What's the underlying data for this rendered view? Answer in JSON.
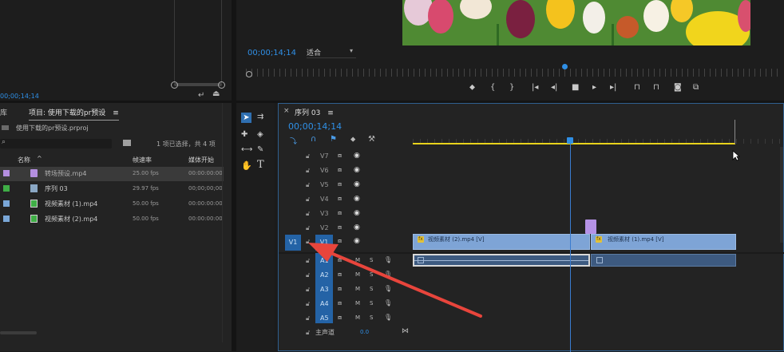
{
  "source_monitor": {
    "timecode": "00;00;14;14"
  },
  "program_monitor": {
    "timecode": "00;00;14;14",
    "fit_select": "适合",
    "transport_icons": [
      "marker-icon",
      "mark-in-icon",
      "mark-out-icon",
      "go-to-in-icon",
      "step-back-icon",
      "stop-icon",
      "play-icon",
      "step-forward-icon",
      "lift-icon",
      "extract-icon",
      "export-frame-icon",
      "compare-icon"
    ]
  },
  "project": {
    "cut_tab": "库",
    "tab_title": "项目: 使用下载的pr预设",
    "tab_menu": "≡",
    "file_name": "使用下载的pr预设.prproj",
    "selection_info": "1 项已选择，共 4 项",
    "columns": [
      "名称",
      "帧速率",
      "媒体开始"
    ],
    "rows": [
      {
        "color": "#b48fe0",
        "icon": "preset-icon",
        "name": "转场预设.mp4",
        "fps": "25.00 fps",
        "start": "00:00:00:00",
        "selected": true
      },
      {
        "color": "#3fae46",
        "icon": "sequence-icon",
        "name": "序列 03",
        "fps": "29.97 fps",
        "start": "00;00;00;00",
        "selected": false
      },
      {
        "color": "#7aa7d8",
        "icon": "video-clip-icon",
        "name": "视频素材 (1).mp4",
        "fps": "50.00 fps",
        "start": "00:00:00:00",
        "selected": false
      },
      {
        "color": "#7aa7d8",
        "icon": "video-clip-icon",
        "name": "视频素材 (2).mp4",
        "fps": "50.00 fps",
        "start": "00:00:00:00",
        "selected": false
      }
    ]
  },
  "tools": [
    "selection-tool",
    "track-select-tool",
    "ripple-tool",
    "razor-tool",
    "slip-tool",
    "pen-tool",
    "hand-tool",
    "type-tool"
  ],
  "timeline": {
    "close": "×",
    "tab_title": "序列 03",
    "tab_menu": "≡",
    "timecode": "00;00;14;14",
    "video_tracks": [
      "V7",
      "V6",
      "V5",
      "V4",
      "V3",
      "V2",
      "V1"
    ],
    "audio_tracks": [
      "A1",
      "A2",
      "A3",
      "A4",
      "A5"
    ],
    "source_patch_video": "V1",
    "source_patch_audio": "A1",
    "mute_label": "M",
    "solo_label": "S",
    "master_label": "主声道",
    "master_value": "0.0",
    "clip1_name": "视频素材 (2).mp4 [V]",
    "clip2_name": "视频素材 (1).mp4 [V]",
    "fx_badge": "fx"
  },
  "colors": {
    "accent_blue": "#2f8fe6",
    "clip_blue": "#7ea4d6",
    "audio_clip": "#3d5a80",
    "arrow_red": "#e8453c",
    "transition_purple": "#b592e6",
    "playhead_yellow": "#e8d21c"
  }
}
